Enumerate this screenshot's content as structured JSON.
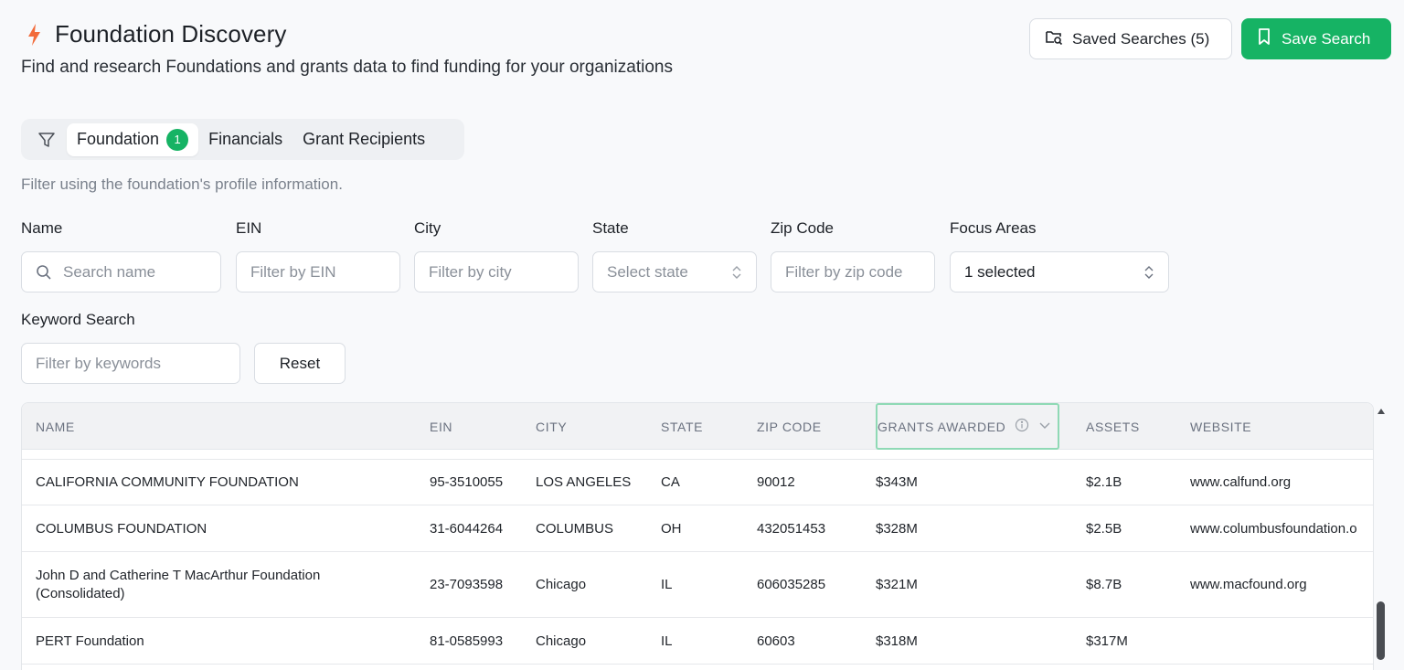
{
  "header": {
    "title": "Foundation Discovery",
    "subtitle": "Find and research Foundations and grants data to find funding for your organizations",
    "saved_searches_label": "Saved Searches (5)",
    "save_search_label": "Save Search"
  },
  "colors": {
    "accent_green": "#16b364",
    "bolt_orange": "#f26b3a"
  },
  "tabs": {
    "items": [
      {
        "label": "Foundation",
        "badge": "1"
      },
      {
        "label": "Financials"
      },
      {
        "label": "Grant Recipients"
      }
    ]
  },
  "hint": "Filter using the foundation's profile information.",
  "filters": {
    "name": {
      "label": "Name",
      "placeholder": "Search name"
    },
    "ein": {
      "label": "EIN",
      "placeholder": "Filter by EIN"
    },
    "city": {
      "label": "City",
      "placeholder": "Filter by city"
    },
    "state": {
      "label": "State",
      "placeholder": "Select state"
    },
    "zip": {
      "label": "Zip Code",
      "placeholder": "Filter by zip code"
    },
    "focus": {
      "label": "Focus Areas",
      "value": "1 selected"
    },
    "keyword": {
      "label": "Keyword Search",
      "placeholder": "Filter by keywords"
    },
    "reset_label": "Reset"
  },
  "table": {
    "columns": [
      "NAME",
      "EIN",
      "CITY",
      "STATE",
      "ZIP CODE",
      "GRANTS AWARDED",
      "ASSETS",
      "WEBSITE"
    ],
    "sorted_column": "GRANTS AWARDED",
    "rows": [
      {
        "name": "CALIFORNIA COMMUNITY FOUNDATION",
        "ein": "95-3510055",
        "city": "LOS ANGELES",
        "state": "CA",
        "zip": "90012",
        "grants": "$343M",
        "assets": "$2.1B",
        "website": "www.calfund.org"
      },
      {
        "name": "COLUMBUS FOUNDATION",
        "ein": "31-6044264",
        "city": "COLUMBUS",
        "state": "OH",
        "zip": "432051453",
        "grants": "$328M",
        "assets": "$2.5B",
        "website": "www.columbusfoundation.o"
      },
      {
        "name": "John D and Catherine T MacArthur Foundation (Consolidated)",
        "ein": "23-7093598",
        "city": "Chicago",
        "state": "IL",
        "zip": "606035285",
        "grants": "$321M",
        "assets": "$8.7B",
        "website": "www.macfound.org"
      },
      {
        "name": "PERT Foundation",
        "ein": "81-0585993",
        "city": "Chicago",
        "state": "IL",
        "zip": "60603",
        "grants": "$318M",
        "assets": "$317M",
        "website": ""
      }
    ]
  }
}
